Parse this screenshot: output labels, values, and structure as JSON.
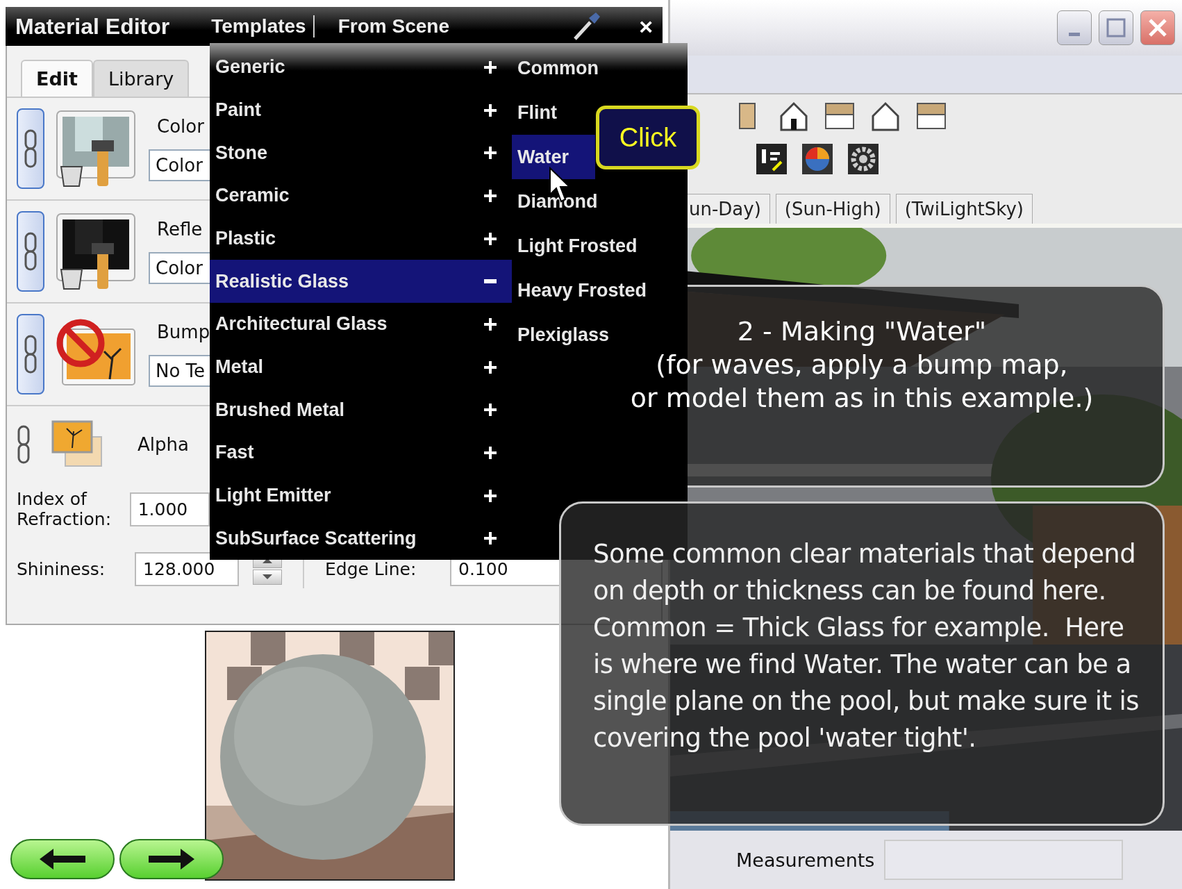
{
  "material_editor": {
    "title": "Material Editor",
    "menu": [
      {
        "label": "Templates"
      },
      {
        "label": "From Scene"
      }
    ],
    "close": "×",
    "tabs": [
      {
        "label": "Edit",
        "selected": true
      },
      {
        "label": "Library",
        "selected": false
      }
    ],
    "texture_rows": [
      {
        "kind": "color",
        "label": "Color",
        "field": "Color"
      },
      {
        "kind": "reflection",
        "label": "Refle",
        "field": "Color"
      },
      {
        "kind": "bump",
        "label": "Bump",
        "field": "No Te"
      }
    ],
    "alpha": {
      "label": "Alpha"
    },
    "index_of_refraction": {
      "label": "Index of Refraction:",
      "value": "1.000"
    },
    "shininess": {
      "label": "Shininess:",
      "value": "128.000"
    },
    "edge_line": {
      "label": "Edge Line:",
      "value": "0.100"
    }
  },
  "templates_menu": {
    "categories": [
      {
        "label": "Generic",
        "expanded": false,
        "selected": false
      },
      {
        "label": "Paint",
        "expanded": false,
        "selected": false
      },
      {
        "label": "Stone",
        "expanded": false,
        "selected": false
      },
      {
        "label": "Ceramic",
        "expanded": false,
        "selected": false
      },
      {
        "label": "Plastic",
        "expanded": false,
        "selected": false
      },
      {
        "label": "Realistic Glass",
        "expanded": true,
        "selected": true
      },
      {
        "label": "Architectural Glass",
        "expanded": false,
        "selected": false
      },
      {
        "label": "Metal",
        "expanded": false,
        "selected": false
      },
      {
        "label": "Brushed Metal",
        "expanded": false,
        "selected": false
      },
      {
        "label": "Fast",
        "expanded": false,
        "selected": false
      },
      {
        "label": "Light Emitter",
        "expanded": false,
        "selected": false
      },
      {
        "label": "SubSurface Scattering",
        "expanded": false,
        "selected": false
      }
    ],
    "submenu": [
      {
        "label": "Common",
        "selected": false
      },
      {
        "label": "Flint",
        "selected": false
      },
      {
        "label": "Water",
        "selected": true
      },
      {
        "label": "Diamond",
        "selected": false
      },
      {
        "label": "Light Frosted",
        "selected": false
      },
      {
        "label": "Heavy Frosted",
        "selected": false
      },
      {
        "label": "Plexiglass",
        "selected": false
      }
    ]
  },
  "callout": {
    "text": "Click"
  },
  "sketchup_window": {
    "scene_tabs": [
      {
        "label": "un-Day)"
      },
      {
        "label": "(Sun-High)"
      },
      {
        "label": "(TwiLightSky)"
      }
    ],
    "status_bar": {
      "label": "Measurements"
    }
  },
  "tutorial": {
    "heading_lines": [
      "2 - Making \"Water\"",
      "(for waves, apply a bump map,",
      "or model them as in this example.)"
    ],
    "body": "Some common clear materials that depend on depth or thickness can be found here. Common = Thick Glass for example.  Here is where we find Water. The water can be a single plane on the pool, but make sure it is covering the pool 'water tight'."
  }
}
